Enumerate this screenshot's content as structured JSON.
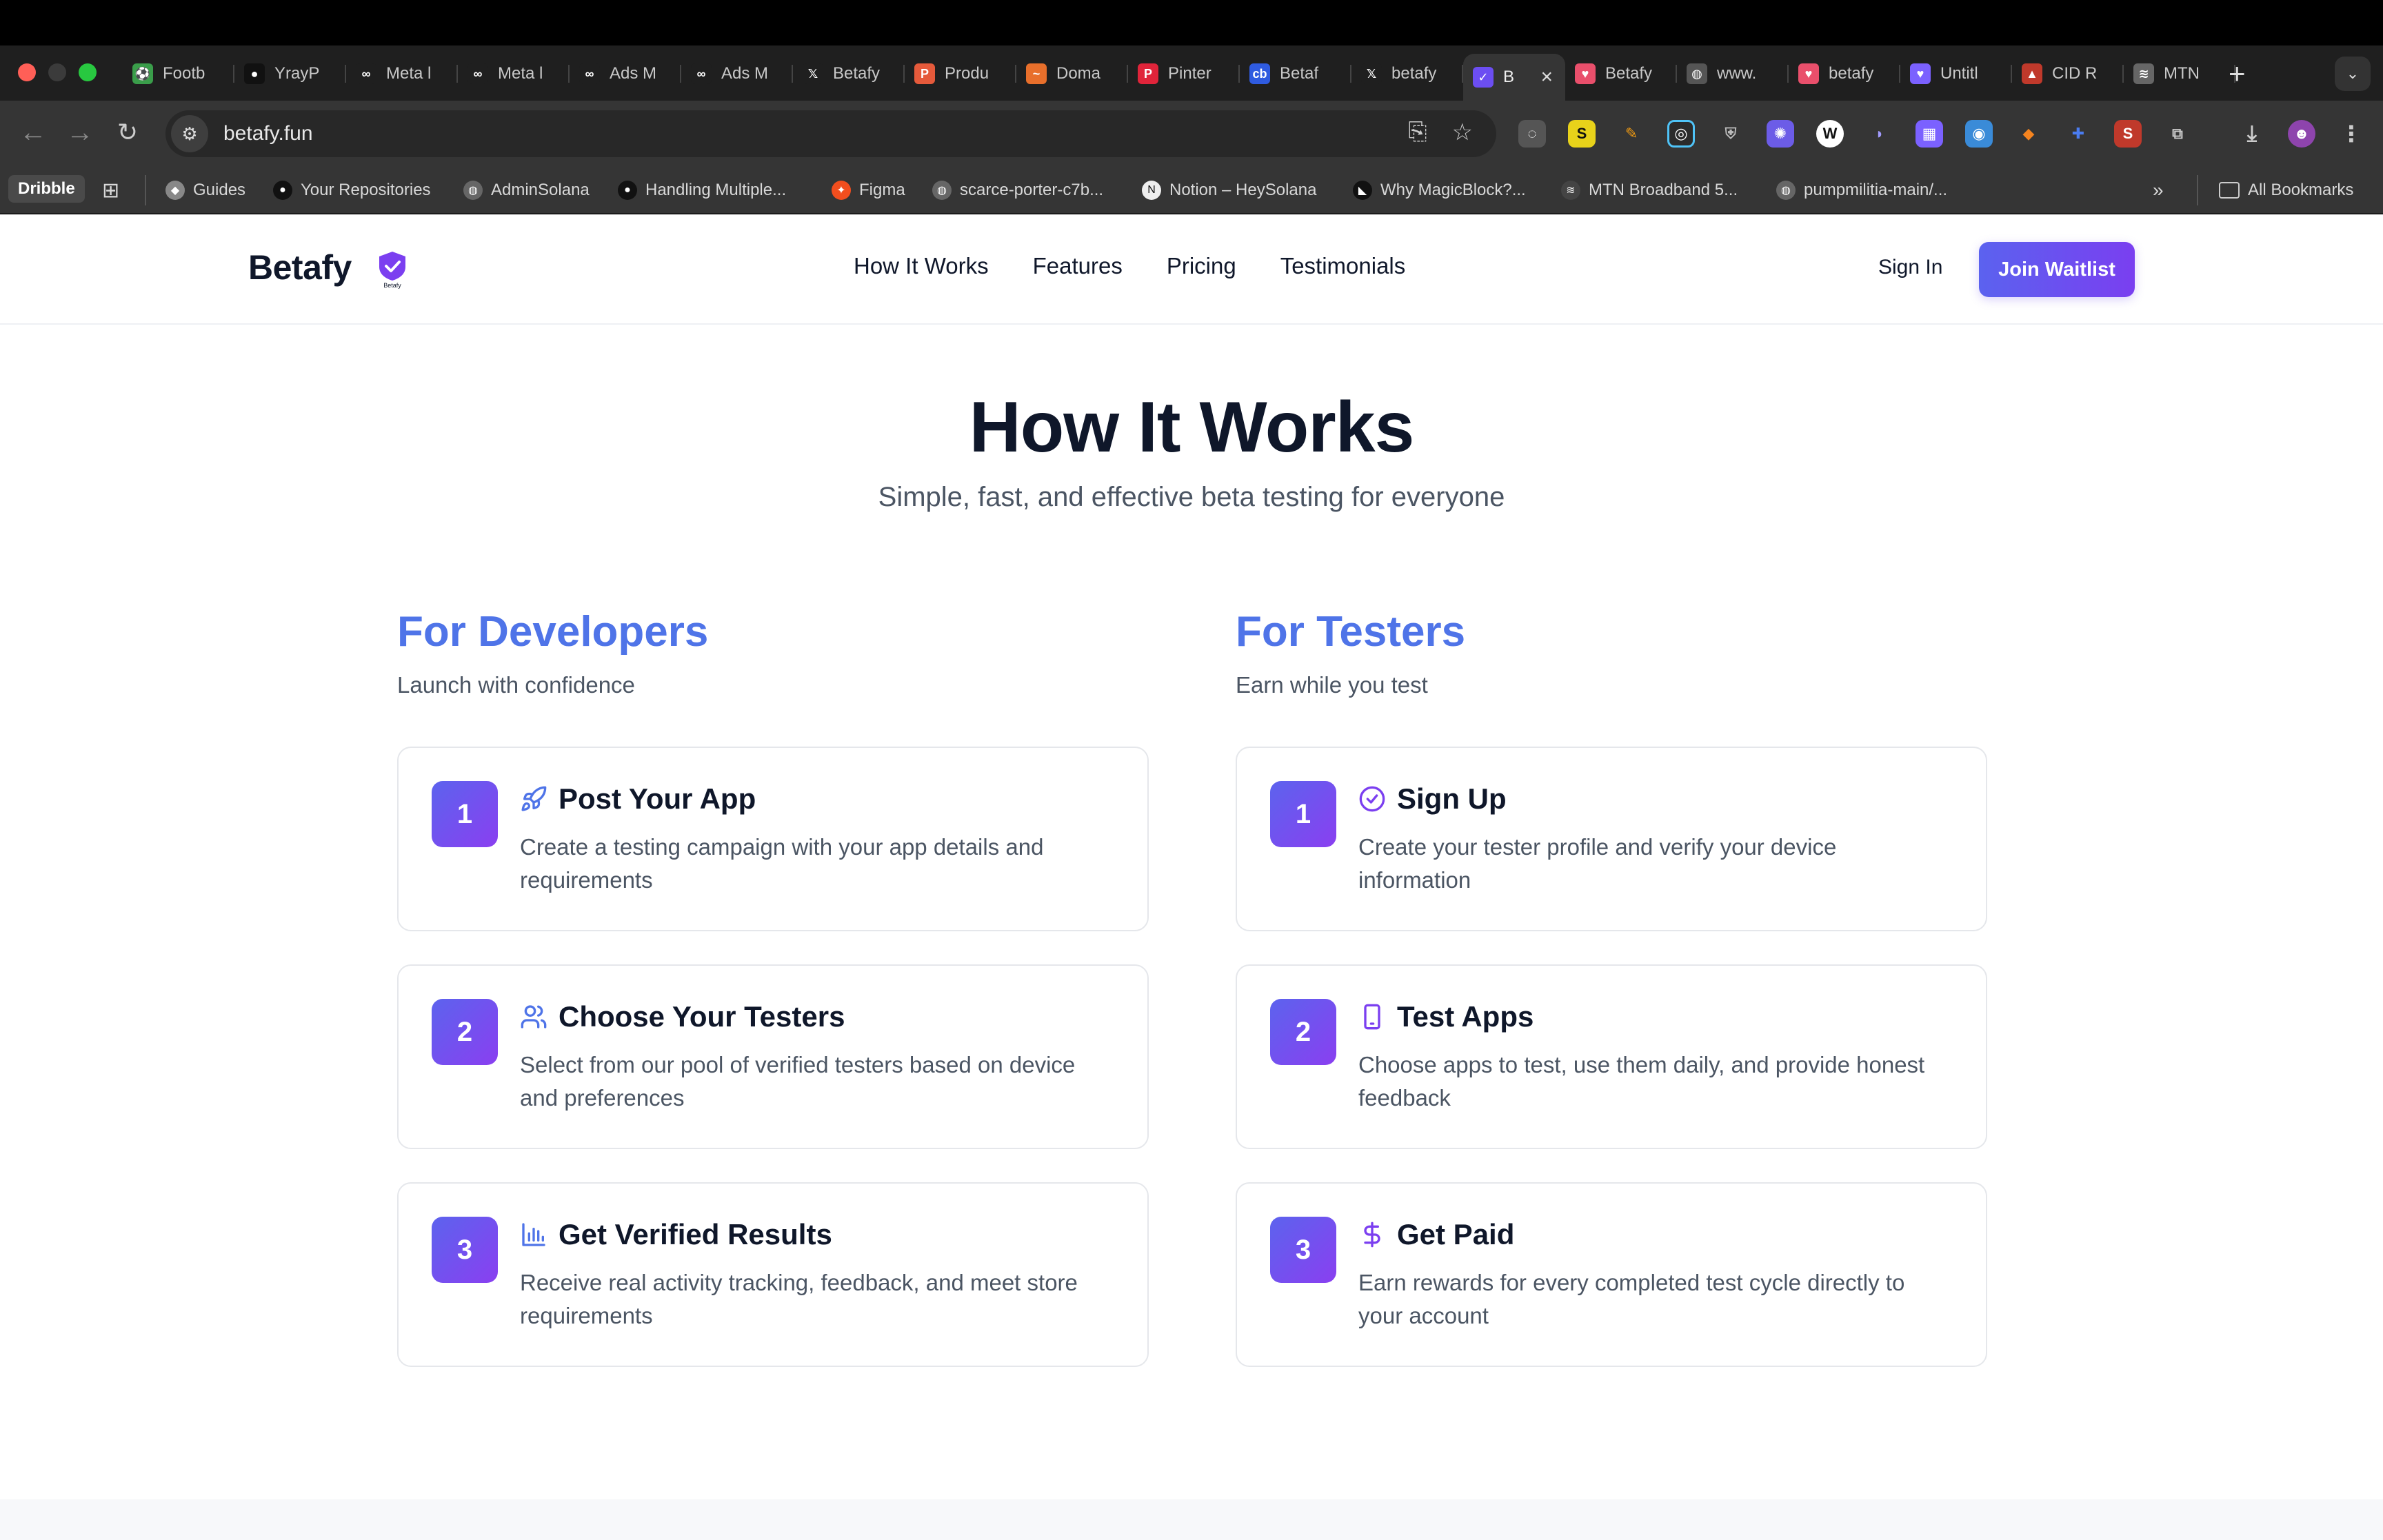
{
  "browser": {
    "tabs": [
      {
        "title": "Footb",
        "color": "#3a9d4a",
        "glyph": "⚽"
      },
      {
        "title": "YrayP",
        "color": "#111111",
        "glyph": "●"
      },
      {
        "title": "Meta l",
        "color": "#1f1f1f",
        "glyph": "∞"
      },
      {
        "title": "Meta l",
        "color": "#1f1f1f",
        "glyph": "∞"
      },
      {
        "title": "Ads M",
        "color": "#1f1f1f",
        "glyph": "∞"
      },
      {
        "title": "Ads M",
        "color": "#1f1f1f",
        "glyph": "∞"
      },
      {
        "title": "Betafy",
        "color": "#1f1f1f",
        "glyph": "𝕏"
      },
      {
        "title": "Produ",
        "color": "#e55a3b",
        "glyph": "P"
      },
      {
        "title": "Doma",
        "color": "#e86f2b",
        "glyph": "~"
      },
      {
        "title": "Pinter",
        "color": "#e0243a",
        "glyph": "P"
      },
      {
        "title": "Betaf",
        "color": "#2f5be0",
        "glyph": "cb"
      },
      {
        "title": "betafy",
        "color": "#1f1f1f",
        "glyph": "𝕏"
      },
      {
        "title": "B",
        "color": "#6c4ef2",
        "glyph": "✓",
        "active": true
      },
      {
        "title": "Betafy",
        "color": "#e94f6b",
        "glyph": "♥"
      },
      {
        "title": "www.",
        "color": "#555555",
        "glyph": "◍"
      },
      {
        "title": "betafy",
        "color": "#e94f6b",
        "glyph": "♥"
      },
      {
        "title": "Untitl",
        "color": "#7b61ff",
        "glyph": "♥"
      },
      {
        "title": "CID R",
        "color": "#c0392b",
        "glyph": "▲"
      },
      {
        "title": "MTN",
        "color": "#666666",
        "glyph": "≋"
      }
    ],
    "url": "betafy.fun",
    "bookmarks": {
      "dribble": "Dribble",
      "items": [
        {
          "label": "Guides",
          "color": "#888888",
          "glyph": "◆"
        },
        {
          "label": "Your Repositories",
          "color": "#111111",
          "glyph": "●"
        },
        {
          "label": "AdminSolana",
          "color": "#666666",
          "glyph": "◍"
        },
        {
          "label": "Handling Multiple...",
          "color": "#111111",
          "glyph": "●"
        },
        {
          "label": "Figma",
          "color": "#f24e1e",
          "glyph": "✦"
        },
        {
          "label": "scarce-porter-c7b...",
          "color": "#666666",
          "glyph": "◍"
        },
        {
          "label": "Notion – HeySolana",
          "color": "#eeeeee",
          "glyph": "N"
        },
        {
          "label": "Why MagicBlock?...",
          "color": "#111111",
          "glyph": "◣"
        },
        {
          "label": "MTN Broadband 5...",
          "color": "#444444",
          "glyph": "≋"
        },
        {
          "label": "pumpmilitia-main/...",
          "color": "#666666",
          "glyph": "◍"
        }
      ],
      "all_bookmarks": "All Bookmarks"
    }
  },
  "site": {
    "brand": "Betafy",
    "badge_text": "Betafy",
    "nav": [
      "How It Works",
      "Features",
      "Pricing",
      "Testimonials"
    ],
    "sign_in": "Sign In",
    "join_waitlist": "Join Waitlist"
  },
  "hero": {
    "title": "How It Works",
    "subtitle": "Simple, fast, and effective beta testing for everyone"
  },
  "developers": {
    "title": "For Developers",
    "subtitle": "Launch with confidence",
    "steps": [
      {
        "num": "1",
        "icon": "rocket-icon",
        "title": "Post Your App",
        "desc": "Create a testing campaign with your app details and requirements"
      },
      {
        "num": "2",
        "icon": "users-icon",
        "title": "Choose Your Testers",
        "desc": "Select from our pool of verified testers based on device and preferences"
      },
      {
        "num": "3",
        "icon": "bar-chart-icon",
        "title": "Get Verified Results",
        "desc": "Receive real activity tracking, feedback, and meet store requirements"
      }
    ]
  },
  "testers": {
    "title": "For Testers",
    "subtitle": "Earn while you test",
    "steps": [
      {
        "num": "1",
        "icon": "check-circle-icon",
        "title": "Sign Up",
        "desc": "Create your tester profile and verify your device information"
      },
      {
        "num": "2",
        "icon": "smartphone-icon",
        "title": "Test Apps",
        "desc": "Choose apps to test, use them daily, and provide honest feedback"
      },
      {
        "num": "3",
        "icon": "dollar-icon",
        "title": "Get Paid",
        "desc": "Earn rewards for every completed test cycle directly to your account"
      }
    ]
  },
  "colors": {
    "accent_blue": "#4f74e8",
    "gradient_start": "#5c63ee",
    "gradient_end": "#8a3ff0",
    "text_dark": "#0f172a",
    "text_muted": "#4b5563"
  }
}
